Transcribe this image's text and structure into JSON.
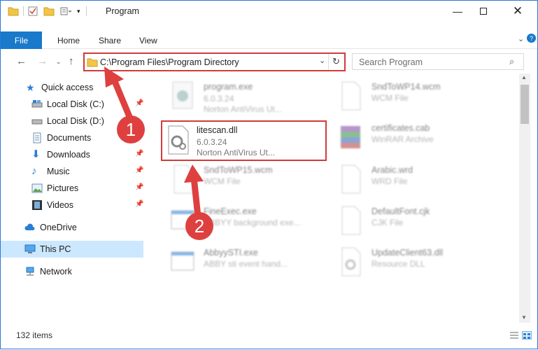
{
  "window": {
    "title": "Program",
    "colors": {
      "accent": "#1979ca",
      "highlight": "#d23a3a",
      "selection": "#cce8ff"
    }
  },
  "ribbon": {
    "tabs": [
      "File",
      "Home",
      "Share",
      "View"
    ]
  },
  "nav": {
    "address": "C:\\Program Files\\Program Directory",
    "search_placeholder": "Search Program"
  },
  "sidebar": {
    "quick_access": "Quick access",
    "items": [
      "Local Disk (C:)",
      "Local Disk (D:)",
      "Documents",
      "Downloads",
      "Music",
      "Pictures",
      "Videos"
    ],
    "onedrive": "OneDrive",
    "this_pc": "This PC",
    "network": "Network"
  },
  "files": [
    {
      "name": "program.exe",
      "size": "6.0.3.24",
      "type": "Norton AntiVirus Ut..."
    },
    {
      "name": "SndToWP14.wcm",
      "size": "",
      "type": "WCM File"
    },
    {
      "name": "litescan.dll",
      "size": "6.0.3.24",
      "type": "Norton AntiVirus Ut..."
    },
    {
      "name": "certificates.cab",
      "size": "",
      "type": "WinRAR Archive"
    },
    {
      "name": "SndToWP15.wcm",
      "size": "",
      "type": "WCM File"
    },
    {
      "name": "Arabic.wrd",
      "size": "",
      "type": "WRD File"
    },
    {
      "name": "FineExec.exe",
      "size": "",
      "type": "ABBYY background exe..."
    },
    {
      "name": "DefaultFont.cjk",
      "size": "",
      "type": "CJK File"
    },
    {
      "name": "AbbyySTI.exe",
      "size": "",
      "type": "ABBY sti event hand..."
    },
    {
      "name": "UpdateClient63.dll",
      "size": "",
      "type": "Resource DLL"
    }
  ],
  "status": {
    "items": "132 items"
  },
  "callouts": [
    "1",
    "2"
  ]
}
